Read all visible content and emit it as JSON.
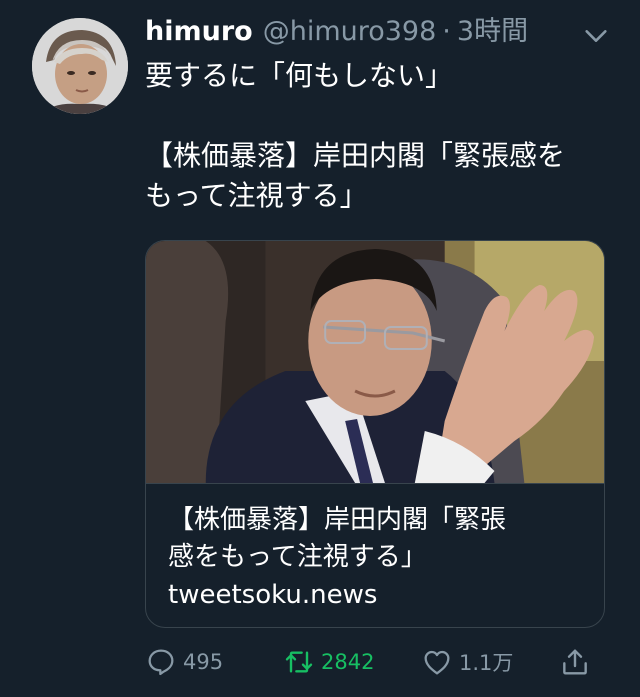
{
  "tweet": {
    "display_name": "himuro",
    "handle": "@himuro398",
    "separator": "·",
    "time": "3時間",
    "text_line1": "要するに「何もしない」",
    "text_line2": "【株価暴落】岸田内閣「緊張感を",
    "text_line3": "もって注視する」"
  },
  "card": {
    "title_line1": "【株価暴落】岸田内閣「緊張",
    "title_line2": "感をもって注視する」",
    "domain": "tweetsoku.news"
  },
  "actions": {
    "reply_count": "495",
    "retweet_count": "2842",
    "like_count": "1.1万"
  },
  "colors": {
    "background": "#15202b",
    "secondary_text": "#8899a6",
    "retweet_active": "#17bf63",
    "border": "#38444d"
  },
  "icons": {
    "menu": "chevron-down-icon",
    "reply": "reply-icon",
    "retweet": "retweet-icon",
    "like": "heart-icon",
    "share": "share-icon"
  }
}
